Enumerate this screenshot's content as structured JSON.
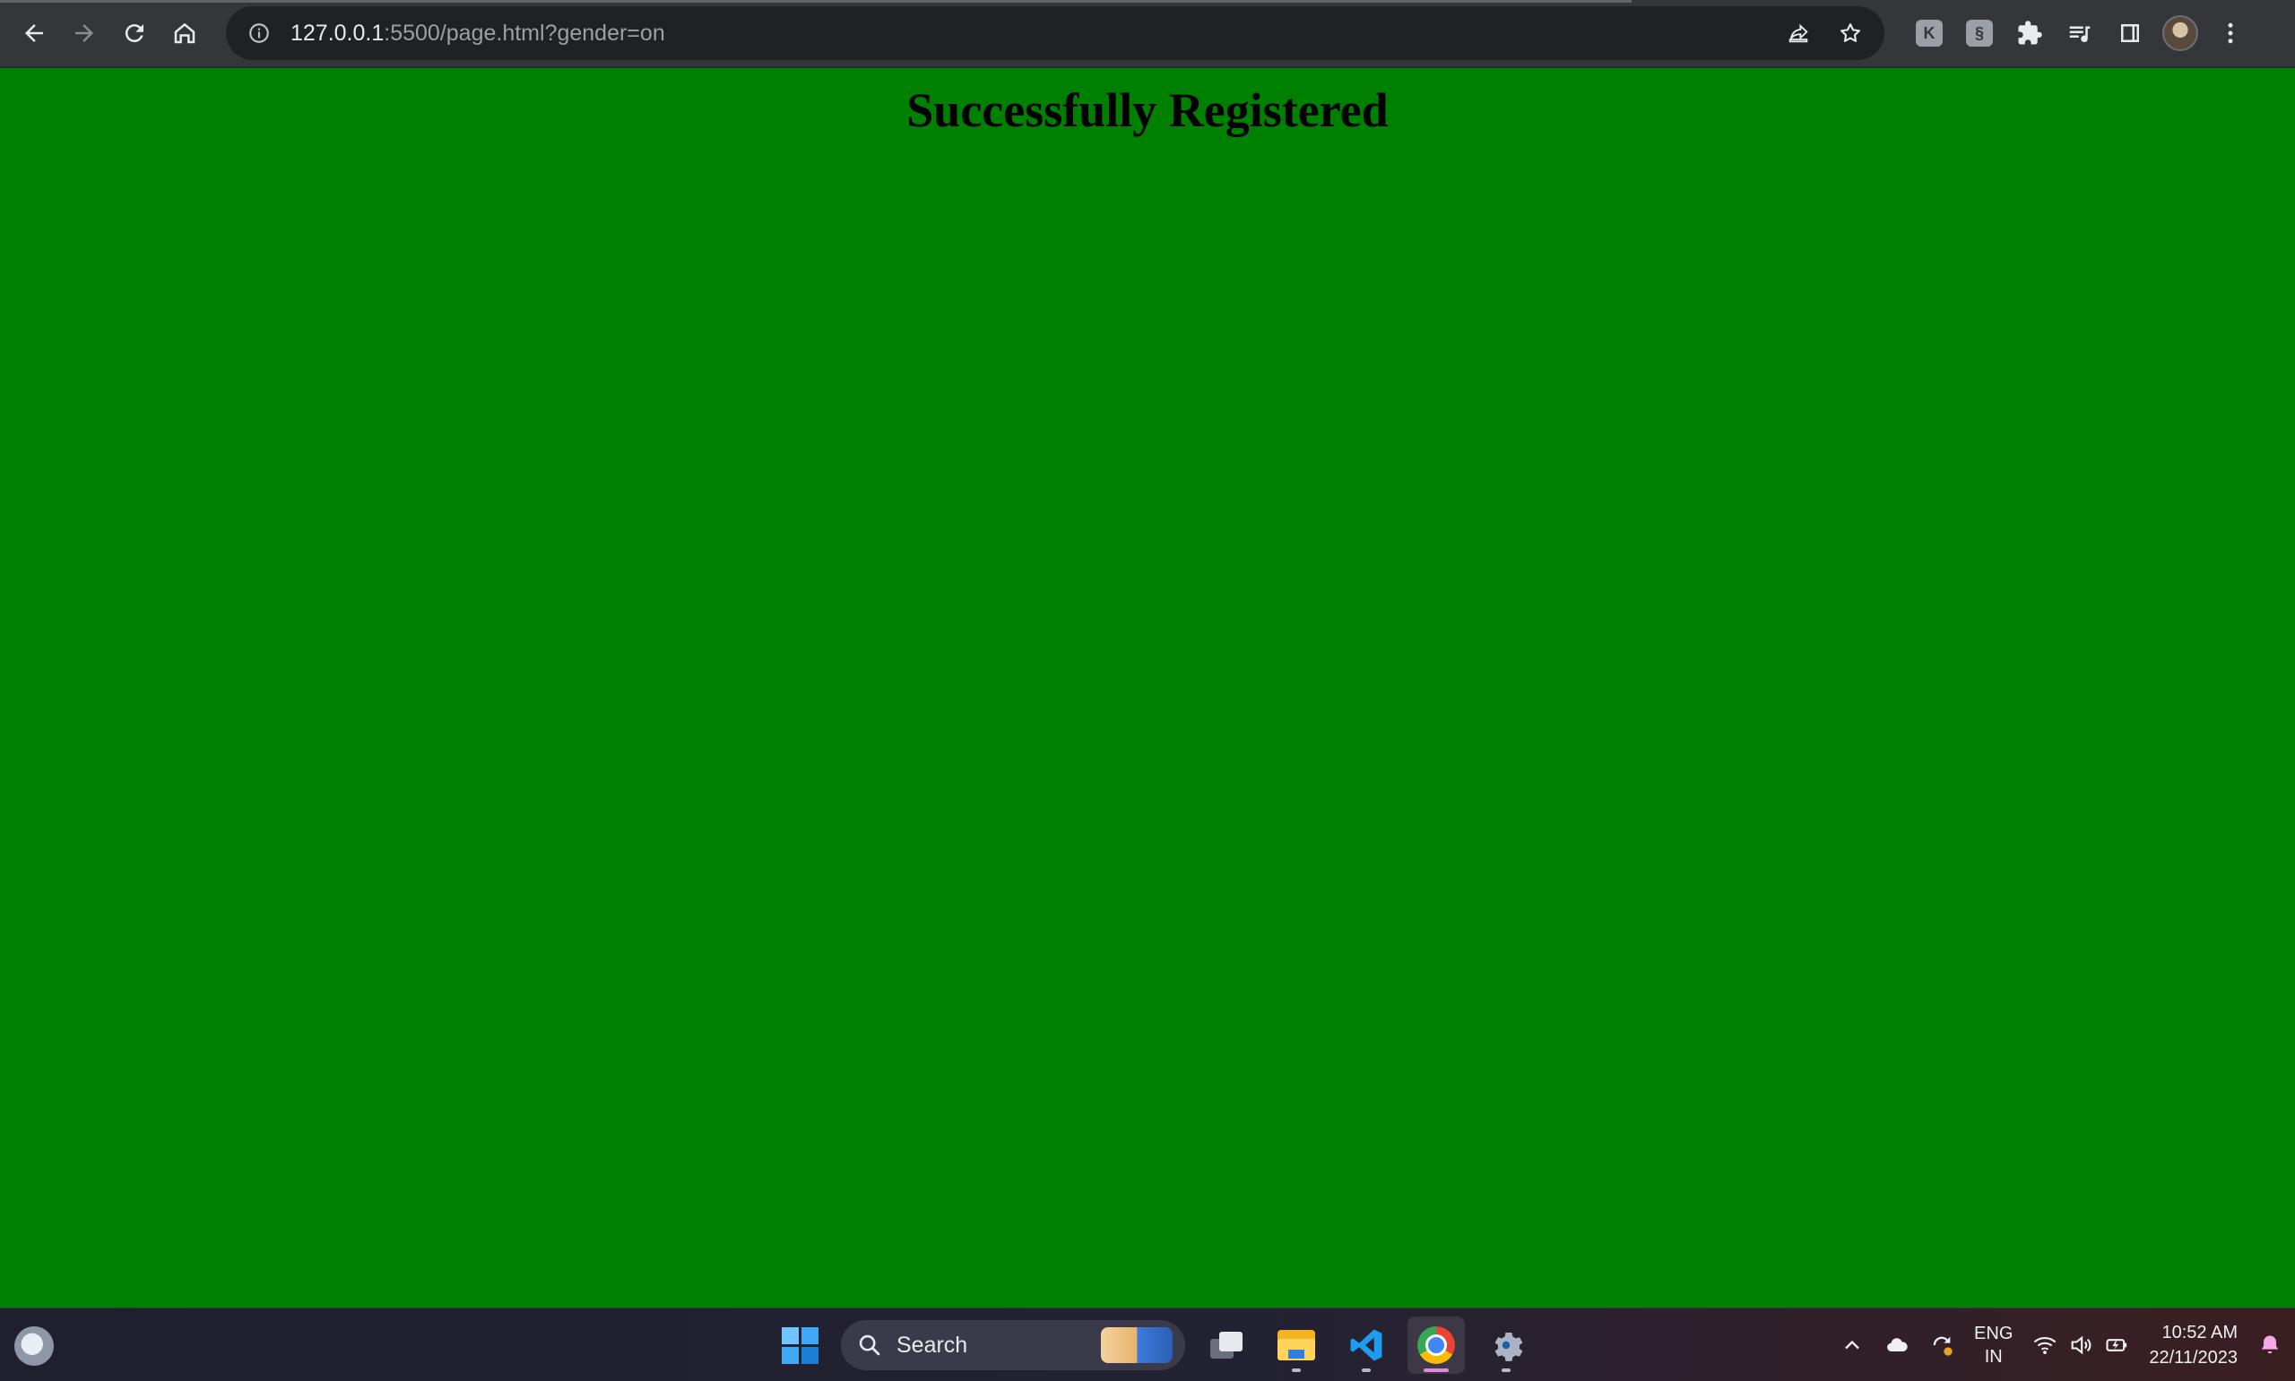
{
  "browser": {
    "url_host": "127.0.0.1",
    "url_rest": ":5500/page.html?gender=on"
  },
  "page": {
    "heading": "Successfully Registered",
    "background": "#008000"
  },
  "taskbar": {
    "search_label": "Search",
    "lang_top": "ENG",
    "lang_bottom": "IN",
    "time": "10:52 AM",
    "date": "22/11/2023"
  },
  "icons": {
    "back": "arrow-left-icon",
    "forward": "arrow-right-icon",
    "reload": "reload-icon",
    "home": "home-icon",
    "site_info": "info-icon",
    "share": "share-icon",
    "bookmark": "star-icon",
    "extensions": "puzzle-icon",
    "media": "playlist-icon",
    "side_panel": "side-panel-icon",
    "menu": "kebab-menu-icon"
  }
}
